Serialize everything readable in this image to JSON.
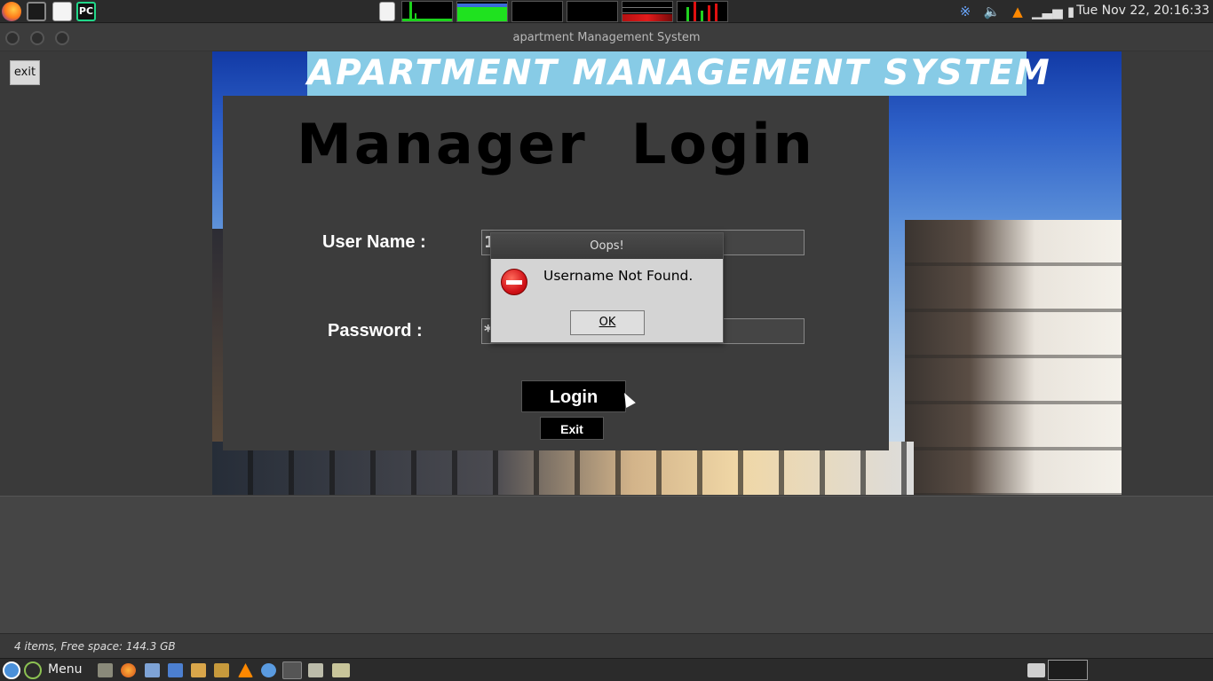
{
  "top_panel": {
    "clock": "Tue Nov 22, 20:16:33",
    "launchers": [
      "firefox-icon",
      "terminal-icon",
      "text-editor-icon",
      "pycharm-icon"
    ],
    "pycharm_label": "PC"
  },
  "window": {
    "title": "apartment Management System"
  },
  "app": {
    "exit_small_label": "exit",
    "main_title": "APARTMENT MANAGEMENT SYSTEM",
    "login_heading": "Manager  Login",
    "username_label": "User Name :",
    "username_value": "1",
    "password_label": "Password :",
    "password_value": "*",
    "login_button": "Login",
    "exit_button": "Exit"
  },
  "dialog": {
    "title": "Oops!",
    "message": "Username Not Found.",
    "ok_label": "OK"
  },
  "file_manager": {
    "status": "4 items, Free space: 144.3 GB"
  },
  "bottom_panel": {
    "menu_label": "Menu"
  },
  "colors": {
    "title_banner": "#87cbe6",
    "panel": "#2b2b2b",
    "login_panel": "#3c3c3c",
    "error_red": "#d2141a"
  }
}
